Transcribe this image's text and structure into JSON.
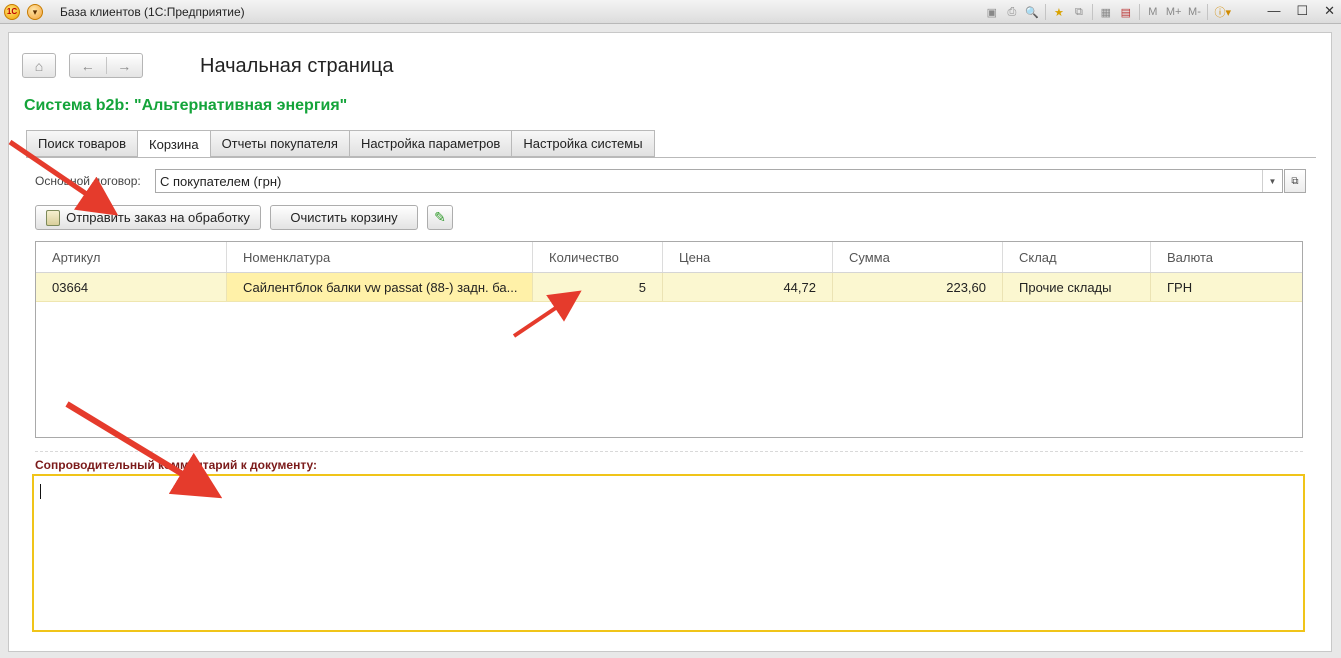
{
  "app": {
    "logo_text": "1С",
    "title": "База клиентов  (1С:Предприятие)",
    "toolbar_labels": [
      "M",
      "M+",
      "M-"
    ]
  },
  "nav": {
    "page_title": "Начальная страница"
  },
  "system_title": "Система b2b: \"Альтернативная энергия\"",
  "tabs": [
    {
      "label": "Поиск товаров",
      "active": false
    },
    {
      "label": "Корзина",
      "active": true
    },
    {
      "label": "Отчеты покупателя",
      "active": false
    },
    {
      "label": "Настройка параметров",
      "active": false
    },
    {
      "label": "Настройка системы",
      "active": false
    }
  ],
  "contract": {
    "label": "Основной договор:",
    "value": "С покупателем (грн)"
  },
  "buttons": {
    "send_order": "Отправить заказ на обработку",
    "clear_cart": "Очистить корзину"
  },
  "table": {
    "columns": [
      "Артикул",
      "Номенклатура",
      "Количество",
      "Цена",
      "Сумма",
      "Склад",
      "Валюта"
    ],
    "rows": [
      [
        "03664",
        "Сайлентблок балки vw passat (88-) задн. ба...",
        "5",
        "44,72",
        "223,60",
        "Прочие склады",
        "ГРН"
      ]
    ]
  },
  "comment": {
    "label": "Сопроводительный комментарий к документу:",
    "value": ""
  },
  "colors": {
    "accent_green": "#14a43a",
    "selected_row": "#fbf7d0",
    "comment_border": "#f0c419",
    "annotation_red": "#e53b2c"
  }
}
